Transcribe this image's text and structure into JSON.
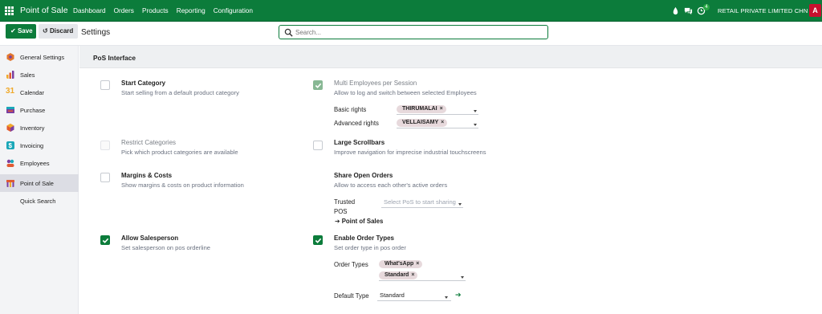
{
  "navbar": {
    "brand": "Point of Sale",
    "menu": [
      "Dashboard",
      "Orders",
      "Products",
      "Reporting",
      "Configuration"
    ],
    "activity_count": "4",
    "company": "RETAIL PRIVATE LIMITED CHN",
    "avatar_initial": "A",
    "colors": {
      "primary": "#0c7c3b",
      "avatar": "#c8102e"
    }
  },
  "control_panel": {
    "save_label": "Save",
    "discard_label": "Discard",
    "title": "Settings",
    "search_placeholder": "Search..."
  },
  "sidebar": {
    "items": [
      {
        "label": "General Settings",
        "icon": "general-settings-icon",
        "active": false
      },
      {
        "label": "Sales",
        "icon": "sales-icon",
        "active": false
      },
      {
        "label": "Calendar",
        "icon": "calendar-icon",
        "active": false
      },
      {
        "label": "Purchase",
        "icon": "purchase-icon",
        "active": false
      },
      {
        "label": "Inventory",
        "icon": "inventory-icon",
        "active": false
      },
      {
        "label": "Invoicing",
        "icon": "invoicing-icon",
        "active": false
      },
      {
        "label": "Employees",
        "icon": "employees-icon",
        "active": false
      },
      {
        "label": "Point of Sale",
        "icon": "point-of-sale-icon",
        "active": true
      },
      {
        "label": "Quick Search",
        "icon": "",
        "active": false
      }
    ]
  },
  "section": {
    "title": "PoS Interface"
  },
  "settings": {
    "start_category": {
      "title": "Start Category",
      "desc": "Start selling from a default product category",
      "checked": false
    },
    "restrict_categories": {
      "title": "Restrict Categories",
      "desc": "Pick which product categories are available",
      "checked": false
    },
    "margins_costs": {
      "title": "Margins & Costs",
      "desc": "Show margins & costs on product information",
      "checked": false
    },
    "allow_salesperson": {
      "title": "Allow Salesperson",
      "desc": "Set salesperson on pos orderline",
      "checked": true
    },
    "multi_employees": {
      "title": "Multi Employees per Session",
      "desc": "Allow to log and switch between selected Employees",
      "checked": true,
      "basic_rights_label": "Basic rights",
      "basic_rights_tags": [
        "THIRUMALAI"
      ],
      "advanced_rights_label": "Advanced rights",
      "advanced_rights_tags": [
        "VELLAISAMY"
      ]
    },
    "large_scrollbars": {
      "title": "Large Scrollbars",
      "desc": "Improve navigation for imprecise industrial touchscreens",
      "checked": false
    },
    "share_open_orders": {
      "title": "Share Open Orders",
      "desc": "Allow to access each other's active orders",
      "trusted_label_1": "Trusted",
      "trusted_label_2": "POS",
      "trusted_placeholder": "Select PoS to start sharing",
      "link": "Point of Sales"
    },
    "enable_order_types": {
      "title": "Enable Order Types",
      "desc": "Set order type in pos order",
      "checked": true,
      "order_types_label": "Order Types",
      "order_types_tags": [
        "What'sApp",
        "Standard"
      ],
      "default_type_label": "Default Type",
      "default_type_value": "Standard"
    }
  }
}
